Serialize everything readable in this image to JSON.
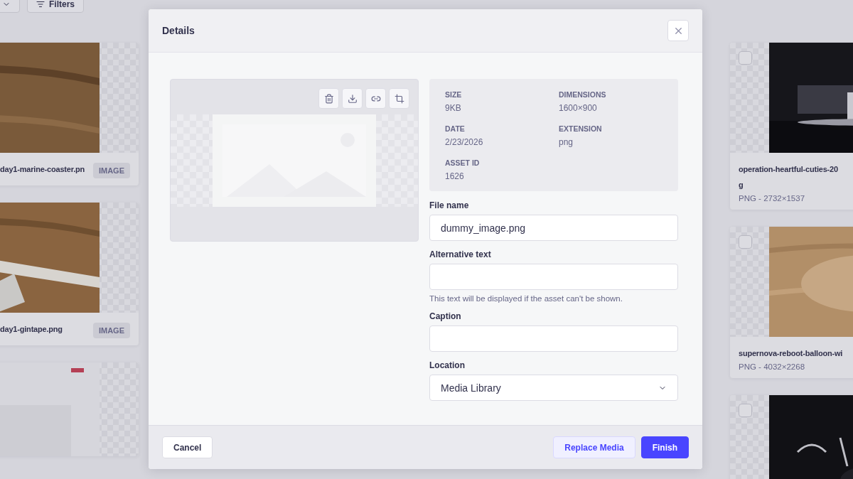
{
  "toolbar": {
    "buttons": [
      {
        "kind": "caret"
      },
      {
        "kind": "filter",
        "label": "Filters"
      }
    ]
  },
  "library": {
    "left_cards": [
      {
        "kind": "picture",
        "name": "day1-marine-coaster.pn",
        "badge": "IMAGE"
      },
      {
        "kind": "picture",
        "name": "day1-gintape.png",
        "badge": "IMAGE"
      },
      {
        "kind": "picture"
      }
    ],
    "right_cards": [
      {
        "kind": "picture",
        "checked": false,
        "name": "operation-heartful-cuties-20",
        "name_more": "g",
        "subtitle": "PNG - 2732×1537"
      },
      {
        "kind": "picture",
        "checked": false,
        "name": "supernova-reboot-balloon-wi",
        "subtitle": "PNG - 4032×2268"
      },
      {
        "kind": "picture",
        "checked": false
      }
    ]
  },
  "dialog": {
    "title": "Details",
    "preview": {
      "actions": [
        {
          "kind": "delete"
        },
        {
          "kind": "download"
        },
        {
          "kind": "link"
        },
        {
          "kind": "crop"
        }
      ],
      "image": {
        "kind": "picture"
      }
    },
    "meta": [
      {
        "label": "SIZE",
        "value": "9KB"
      },
      {
        "label": "DIMENSIONS",
        "value": "1600×900"
      },
      {
        "label": "DATE",
        "value": "2/23/2026"
      },
      {
        "label": "EXTENSION",
        "value": "png"
      },
      {
        "label": "ASSET ID",
        "value": "1626"
      }
    ],
    "fields": [
      {
        "kind": "text",
        "label": "File name",
        "value": "dummy_image.png"
      },
      {
        "kind": "text",
        "label": "Alternative text",
        "hint": "This text will be displayed if the asset can't be shown."
      },
      {
        "kind": "text",
        "label": "Caption"
      },
      {
        "kind": "select",
        "label": "Location",
        "value": "Media Library"
      }
    ],
    "footer": {
      "cancel": "Cancel",
      "secondary": "Replace Media",
      "primary": "Finish"
    }
  }
}
